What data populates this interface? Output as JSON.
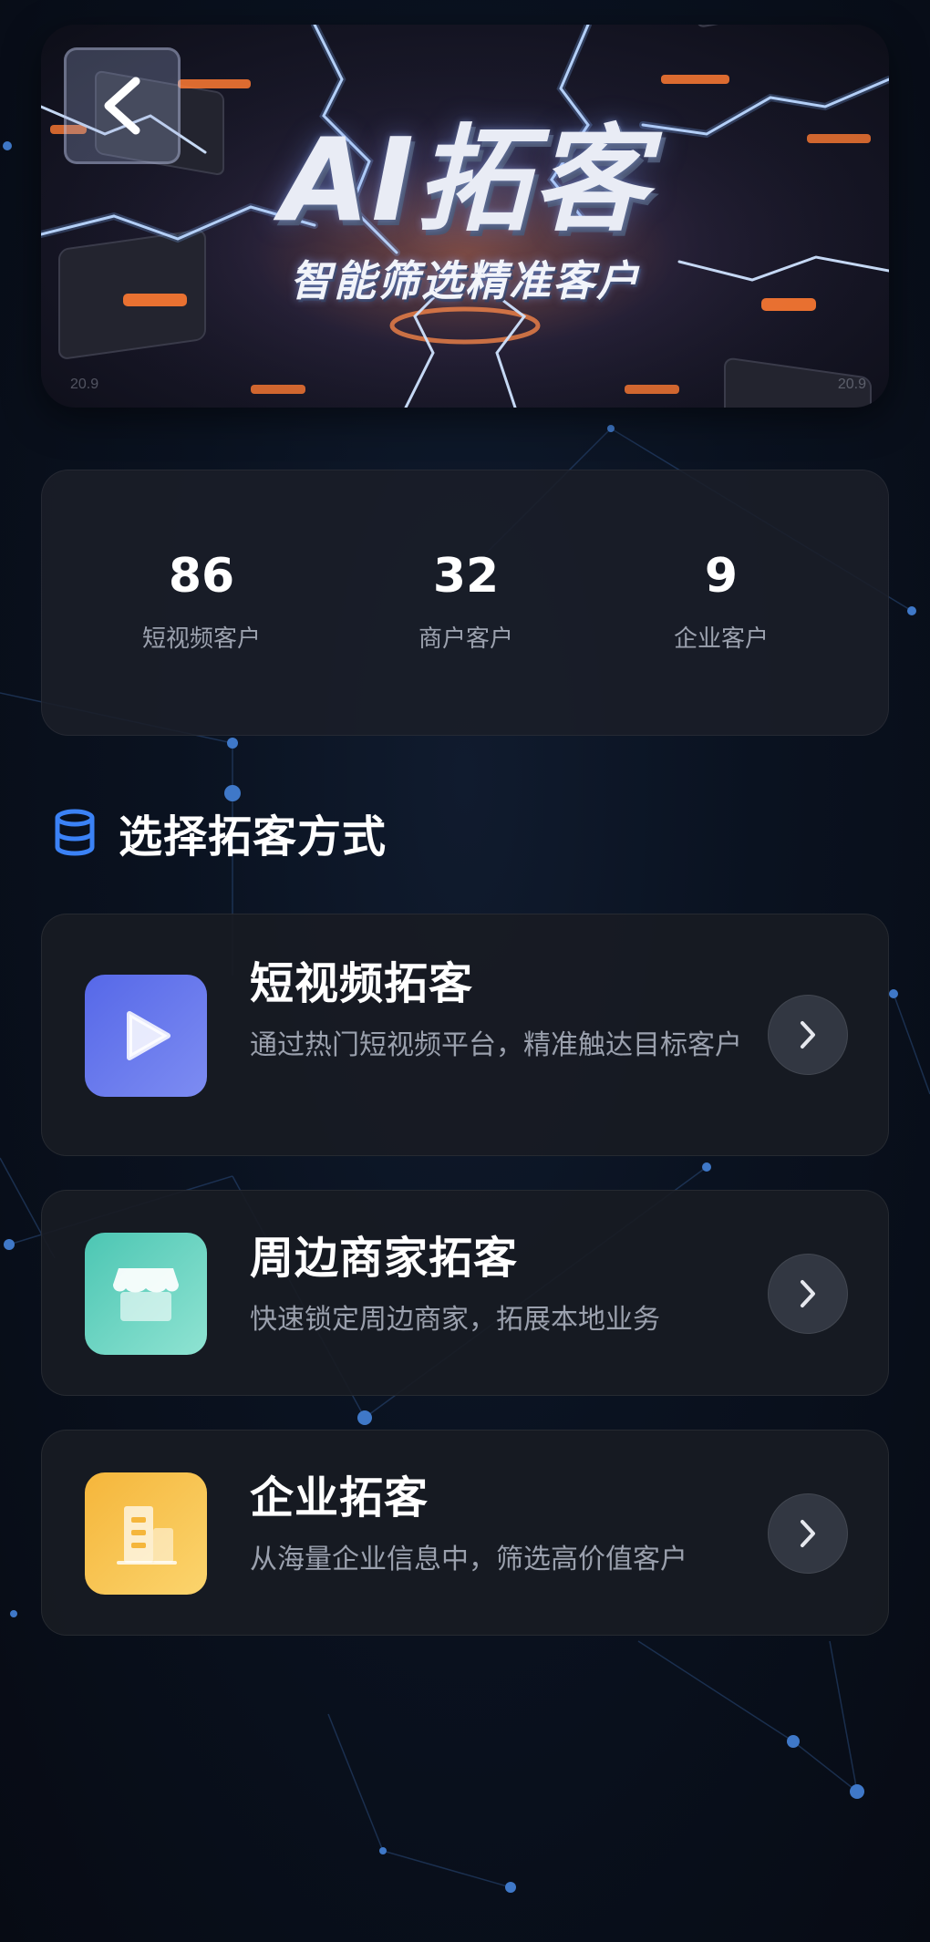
{
  "banner": {
    "title": "AI拓客",
    "subtitle": "智能筛选精准客户",
    "corner_left": "20.9",
    "corner_right": "20.9"
  },
  "stats": [
    {
      "value": "86",
      "label": "短视频客户"
    },
    {
      "value": "32",
      "label": "商户客户"
    },
    {
      "value": "9",
      "label": "企业客户"
    }
  ],
  "section": {
    "title": "选择拓客方式",
    "icon": "database-icon"
  },
  "methods": [
    {
      "title": "短视频拓客",
      "desc": "通过热门短视频平台，精准触达目标客户",
      "icon": "play-icon",
      "color": "#5F6FEA"
    },
    {
      "title": "周边商家拓客",
      "desc": "快速锁定周边商家，拓展本地业务",
      "icon": "store-icon",
      "color": "#5ACDB9"
    },
    {
      "title": "企业拓客",
      "desc": "从海量企业信息中，筛选高价值客户",
      "icon": "building-icon",
      "color": "#F7C14D"
    }
  ],
  "colors": {
    "background": "#0A0F1A",
    "card": "#181B23",
    "accent_blue": "#3B82F6"
  }
}
